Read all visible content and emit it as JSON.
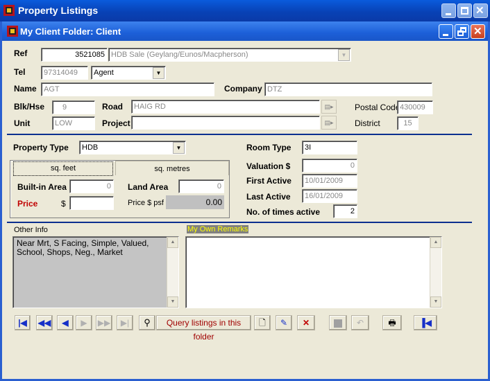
{
  "window": {
    "title": "Property Listings",
    "inner_title": "My Client Folder: Client"
  },
  "form": {
    "ref_label": "Ref",
    "ref_value": "3521085",
    "ref_desc": "HDB Sale (Geylang/Eunos/Macpherson)",
    "tel_label": "Tel",
    "tel_value": "97314049",
    "tel_type": "Agent",
    "name_label": "Name",
    "name_value": "AGT",
    "company_label": "Company",
    "company_value": "DTZ",
    "blk_label": "Blk/Hse",
    "blk_value": "9",
    "road_label": "Road",
    "road_value": "HAIG RD",
    "postal_label": "Postal Code",
    "postal_value": "430009",
    "unit_label": "Unit",
    "unit_value": "LOW",
    "project_label": "Project",
    "project_value": "",
    "district_label": "District",
    "district_value": "15"
  },
  "property": {
    "type_label": "Property Type",
    "type_value": "HDB",
    "sqft_tab": "sq. feet",
    "sqm_tab": "sq. metres",
    "builtin_label": "Built-in Area",
    "builtin_value": "0",
    "land_label": "Land Area",
    "land_value": "0",
    "price_label": "Price",
    "price_currency": "$",
    "price_value": "",
    "psf_label": "Price $ psf",
    "psf_value": "0.00",
    "room_label": "Room Type",
    "room_value": "3I",
    "valuation_label": "Valuation $",
    "valuation_value": "0",
    "first_label": "First Active",
    "first_value": "10/01/2009",
    "last_label": "Last Active",
    "last_value": "16/01/2009",
    "times_label": "No. of times active",
    "times_value": "2"
  },
  "info": {
    "other_label": "Other Info",
    "other_text": "Near Mrt, S Facing, Simple, Valued, School, Shops, Neg., Market",
    "remarks_label": "My Own Remarks",
    "remarks_text": ""
  },
  "toolbar": {
    "query_label": "Query listings in this folder"
  },
  "colors": {
    "title_blue": "#0842b6",
    "separator": "#0b2f8f",
    "price_red": "#c00000",
    "remarks_label_bg": "#808080",
    "remarks_label_fg": "#ffff00"
  }
}
